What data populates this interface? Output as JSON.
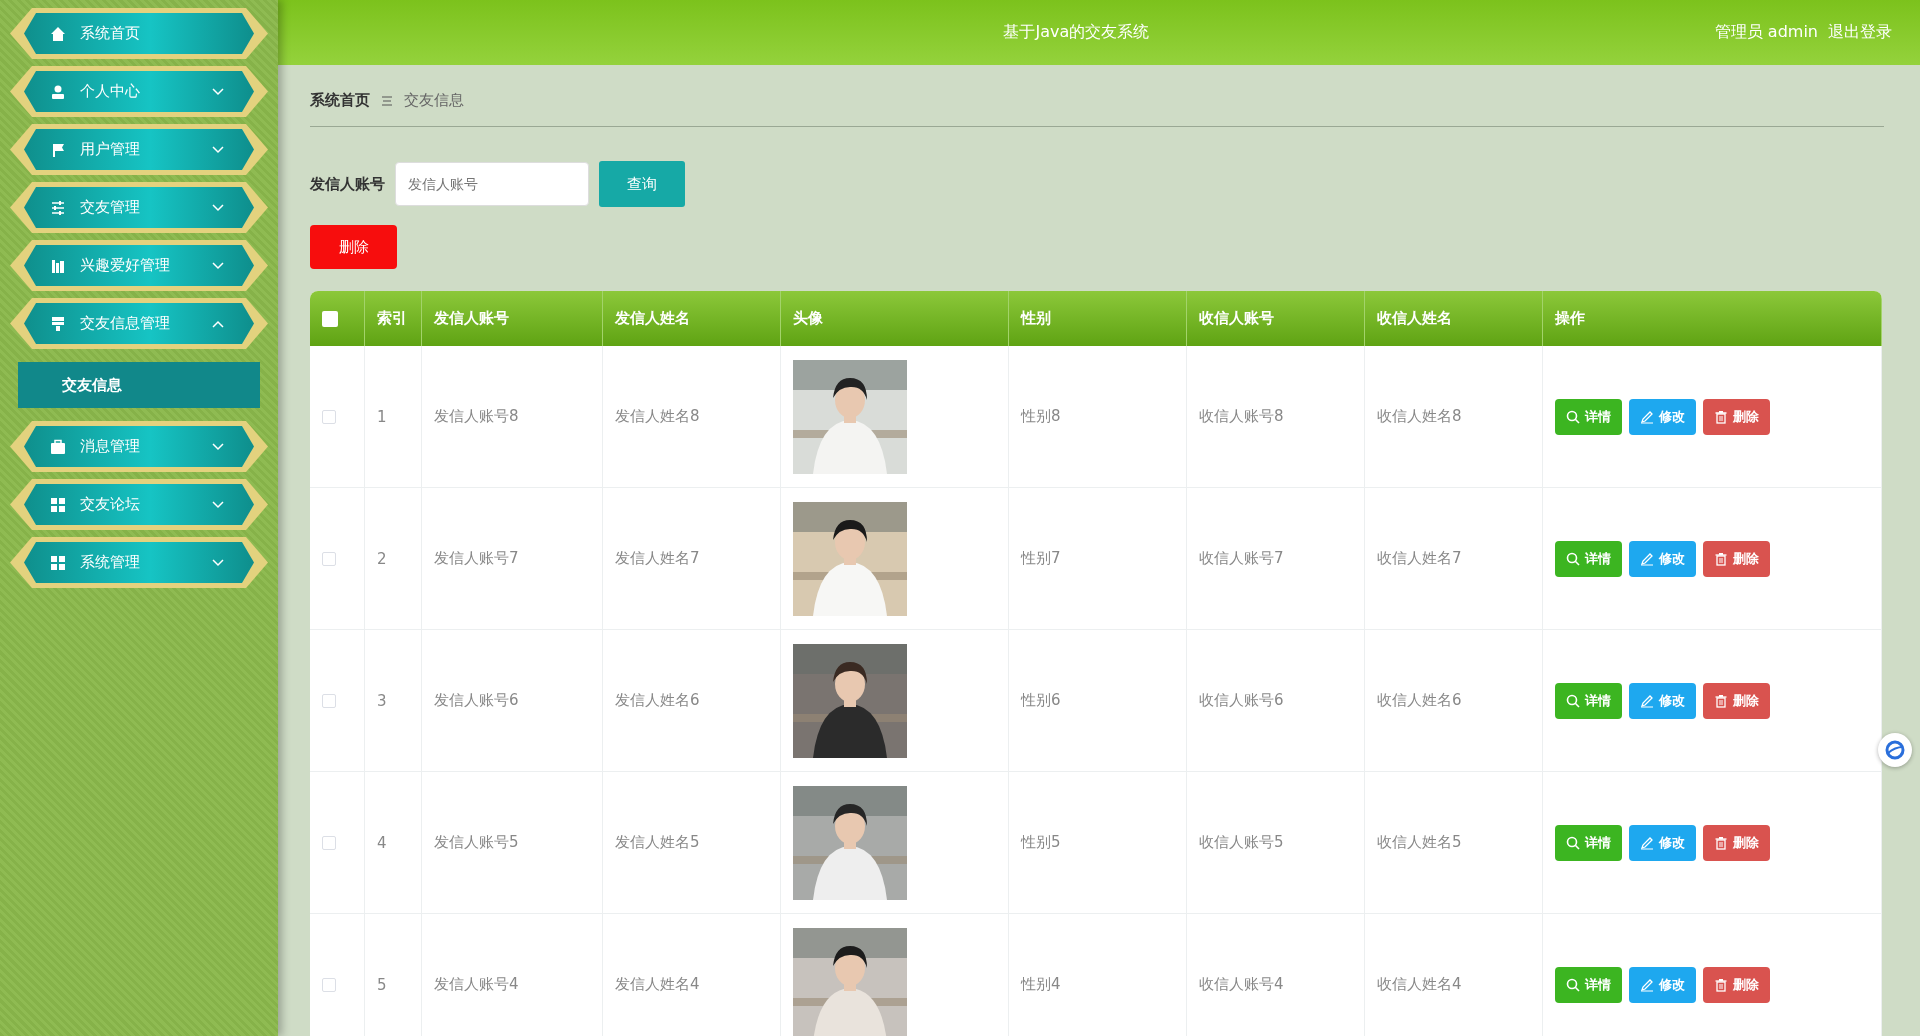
{
  "header": {
    "title": "基于Java的交友系统",
    "user": "管理员 admin",
    "logout": "退出登录"
  },
  "sidebar": {
    "items": [
      {
        "label": "系统首页"
      },
      {
        "label": "个人中心",
        "expanded": false
      },
      {
        "label": "用户管理",
        "expanded": false
      },
      {
        "label": "交友管理",
        "expanded": false
      },
      {
        "label": "兴趣爱好管理",
        "expanded": false
      },
      {
        "label": "交友信息管理",
        "expanded": true,
        "children": [
          {
            "label": "交友信息",
            "selected": true
          }
        ]
      },
      {
        "label": "消息管理",
        "expanded": false
      },
      {
        "label": "交友论坛",
        "expanded": false
      },
      {
        "label": "系统管理",
        "expanded": false
      }
    ]
  },
  "breadcrumb": [
    "系统首页",
    "交友信息"
  ],
  "search": {
    "label": "发信人账号",
    "placeholder": "发信人账号",
    "button": "查询"
  },
  "delete_button": "删除",
  "table": {
    "select_all_checked": false,
    "columns": [
      "索引",
      "发信人账号",
      "发信人姓名",
      "头像",
      "性别",
      "收信人账号",
      "收信人姓名",
      "操作"
    ],
    "rows": [
      {
        "checked": false,
        "index": "1",
        "sender_account": "发信人账号8",
        "sender_name": "发信人姓名8",
        "gender": "性别8",
        "receiver_account": "收信人账号8",
        "receiver_name": "收信人姓名8",
        "actions": [
          "详情",
          "修改",
          "删除"
        ]
      },
      {
        "checked": false,
        "index": "2",
        "sender_account": "发信人账号7",
        "sender_name": "发信人姓名7",
        "gender": "性别7",
        "receiver_account": "收信人账号7",
        "receiver_name": "收信人姓名7",
        "actions": [
          "详情",
          "修改",
          "删除"
        ]
      },
      {
        "checked": false,
        "index": "3",
        "sender_account": "发信人账号6",
        "sender_name": "发信人姓名6",
        "gender": "性别6",
        "receiver_account": "收信人账号6",
        "receiver_name": "收信人姓名6",
        "actions": [
          "详情",
          "修改",
          "删除"
        ]
      },
      {
        "checked": false,
        "index": "4",
        "sender_account": "发信人账号5",
        "sender_name": "发信人姓名5",
        "gender": "性别5",
        "receiver_account": "收信人账号5",
        "receiver_name": "收信人姓名5",
        "actions": [
          "详情",
          "修改",
          "删除"
        ]
      },
      {
        "checked": false,
        "index": "5",
        "sender_account": "发信人账号4",
        "sender_name": "发信人姓名4",
        "gender": "性别4",
        "receiver_account": "收信人账号4",
        "receiver_name": "收信人姓名4",
        "actions": [
          "详情",
          "修改",
          "删除"
        ]
      }
    ]
  }
}
